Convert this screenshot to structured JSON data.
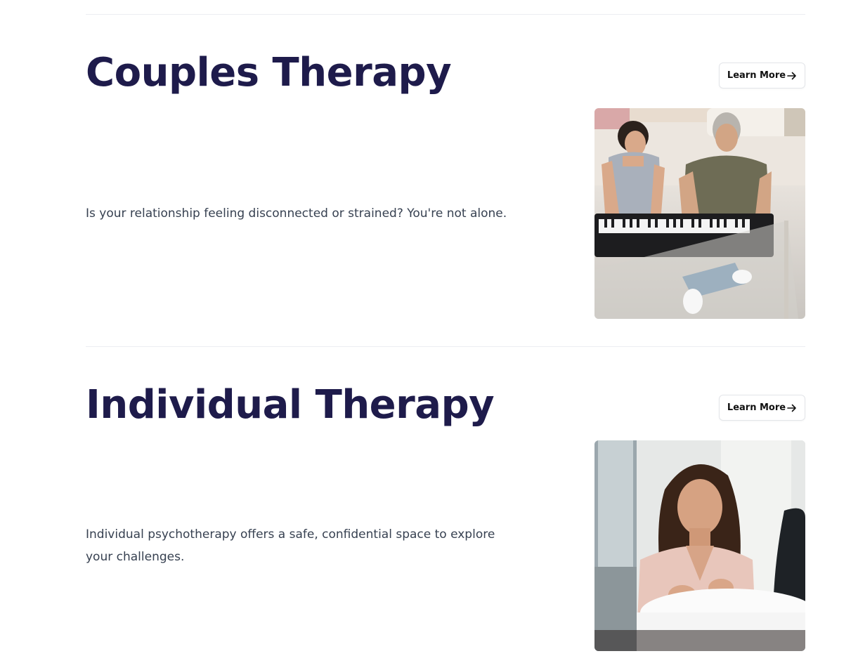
{
  "services": [
    {
      "title": "Couples Therapy",
      "button_label": "Learn More",
      "button_icon": "arrow-right-icon",
      "description": "Is your relationship feeling disconnected or strained? You're not alone.",
      "image": "couple-playing-piano-photo"
    },
    {
      "title": "Individual Therapy",
      "button_label": "Learn More",
      "button_icon": "arrow-right-icon",
      "description": "Individual psychotherapy offers a safe, confidential space to explore your challenges.",
      "image": "woman-talking-at-table-photo"
    }
  ],
  "colors": {
    "heading": "#1e1b4b",
    "body_text": "#374151",
    "divider": "#eceef2",
    "button_border": "#e3e5e9"
  }
}
